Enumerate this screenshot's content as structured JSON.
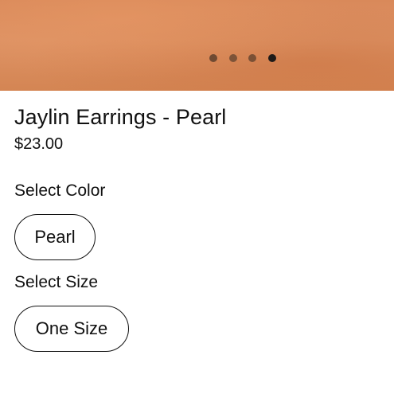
{
  "carousel": {
    "dots": [
      {
        "color": "#6f4a32",
        "active": false
      },
      {
        "color": "#7d5338",
        "active": false
      },
      {
        "color": "#7a5035",
        "active": false
      },
      {
        "color": "#1e1a18",
        "active": true
      }
    ]
  },
  "product": {
    "title": "Jaylin Earrings - Pearl",
    "price": "$23.00"
  },
  "color": {
    "label": "Select Color",
    "selected": "Pearl"
  },
  "size": {
    "label": "Select Size",
    "selected": "One Size"
  }
}
